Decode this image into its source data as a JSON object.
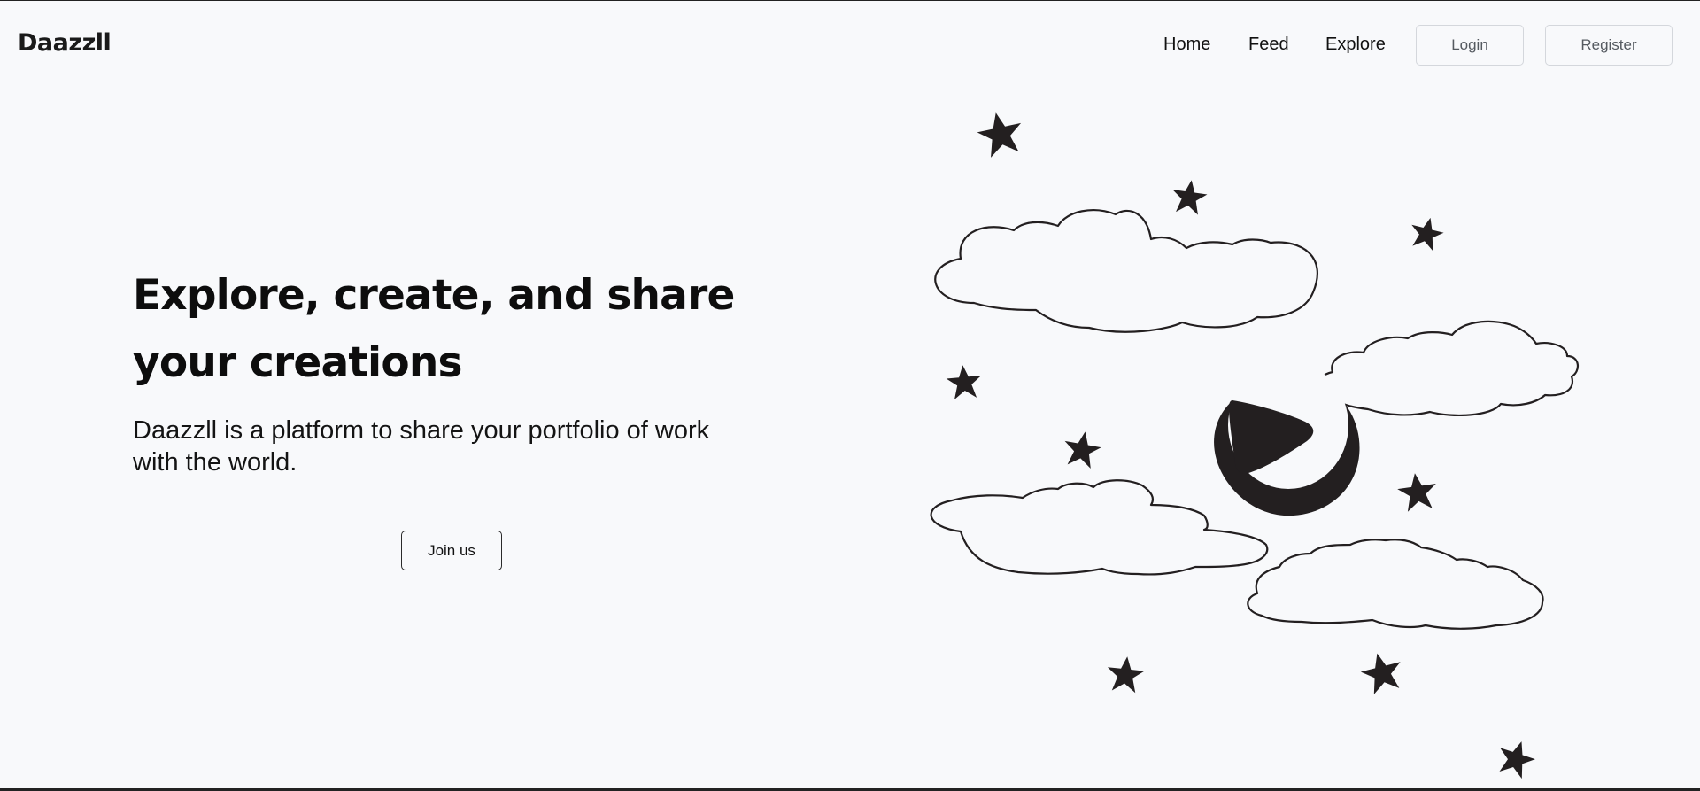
{
  "header": {
    "logo": "Daazzll",
    "nav": {
      "home": "Home",
      "feed": "Feed",
      "explore": "Explore"
    },
    "login_label": "Login",
    "register_label": "Register"
  },
  "hero": {
    "title": "Explore, create, and share your creations",
    "subtitle": "Daazzll is a platform to share your portfolio of work with the world.",
    "cta_label": "Join us"
  },
  "illustration": {
    "icons": [
      "cloud-icon",
      "star-icon",
      "play-icon"
    ],
    "ink_color": "#231f20",
    "background_color": "#f8f9fb"
  },
  "colors": {
    "text": "#111111",
    "border": "#d4d7dc",
    "muted_button_text": "#555a60"
  }
}
